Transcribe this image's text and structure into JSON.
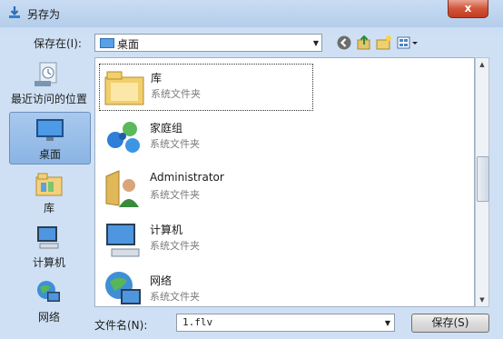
{
  "window": {
    "title": "另存为",
    "close_symbol": "x"
  },
  "toolbar": {
    "savein_label": "保存在(I):",
    "savein_value": "桌面",
    "icons": [
      "back-icon",
      "up-folder-icon",
      "new-folder-icon",
      "view-menu-icon"
    ]
  },
  "places": [
    {
      "label": "最近访问的位置",
      "icon": "recent-places-icon",
      "selected": false
    },
    {
      "label": "桌面",
      "icon": "desktop-icon",
      "selected": true
    },
    {
      "label": "库",
      "icon": "libraries-icon",
      "selected": false
    },
    {
      "label": "计算机",
      "icon": "computer-icon",
      "selected": false
    },
    {
      "label": "网络",
      "icon": "network-icon",
      "selected": false
    }
  ],
  "files": [
    {
      "name": "库",
      "type": "系统文件夹",
      "icon": "library-folder-icon"
    },
    {
      "name": "家庭组",
      "type": "系统文件夹",
      "icon": "homegroup-icon"
    },
    {
      "name": "Administrator",
      "type": "系统文件夹",
      "icon": "user-folder-icon"
    },
    {
      "name": "计算机",
      "type": "系统文件夹",
      "icon": "computer-icon"
    },
    {
      "name": "网络",
      "type": "系统文件夹",
      "icon": "network-icon"
    }
  ],
  "footer": {
    "filename_label": "文件名(N):",
    "filename_value": "1.flv",
    "save_button": "保存(S)"
  },
  "colors": {
    "accent": "#8ab4e4",
    "close": "#c23c1f"
  }
}
